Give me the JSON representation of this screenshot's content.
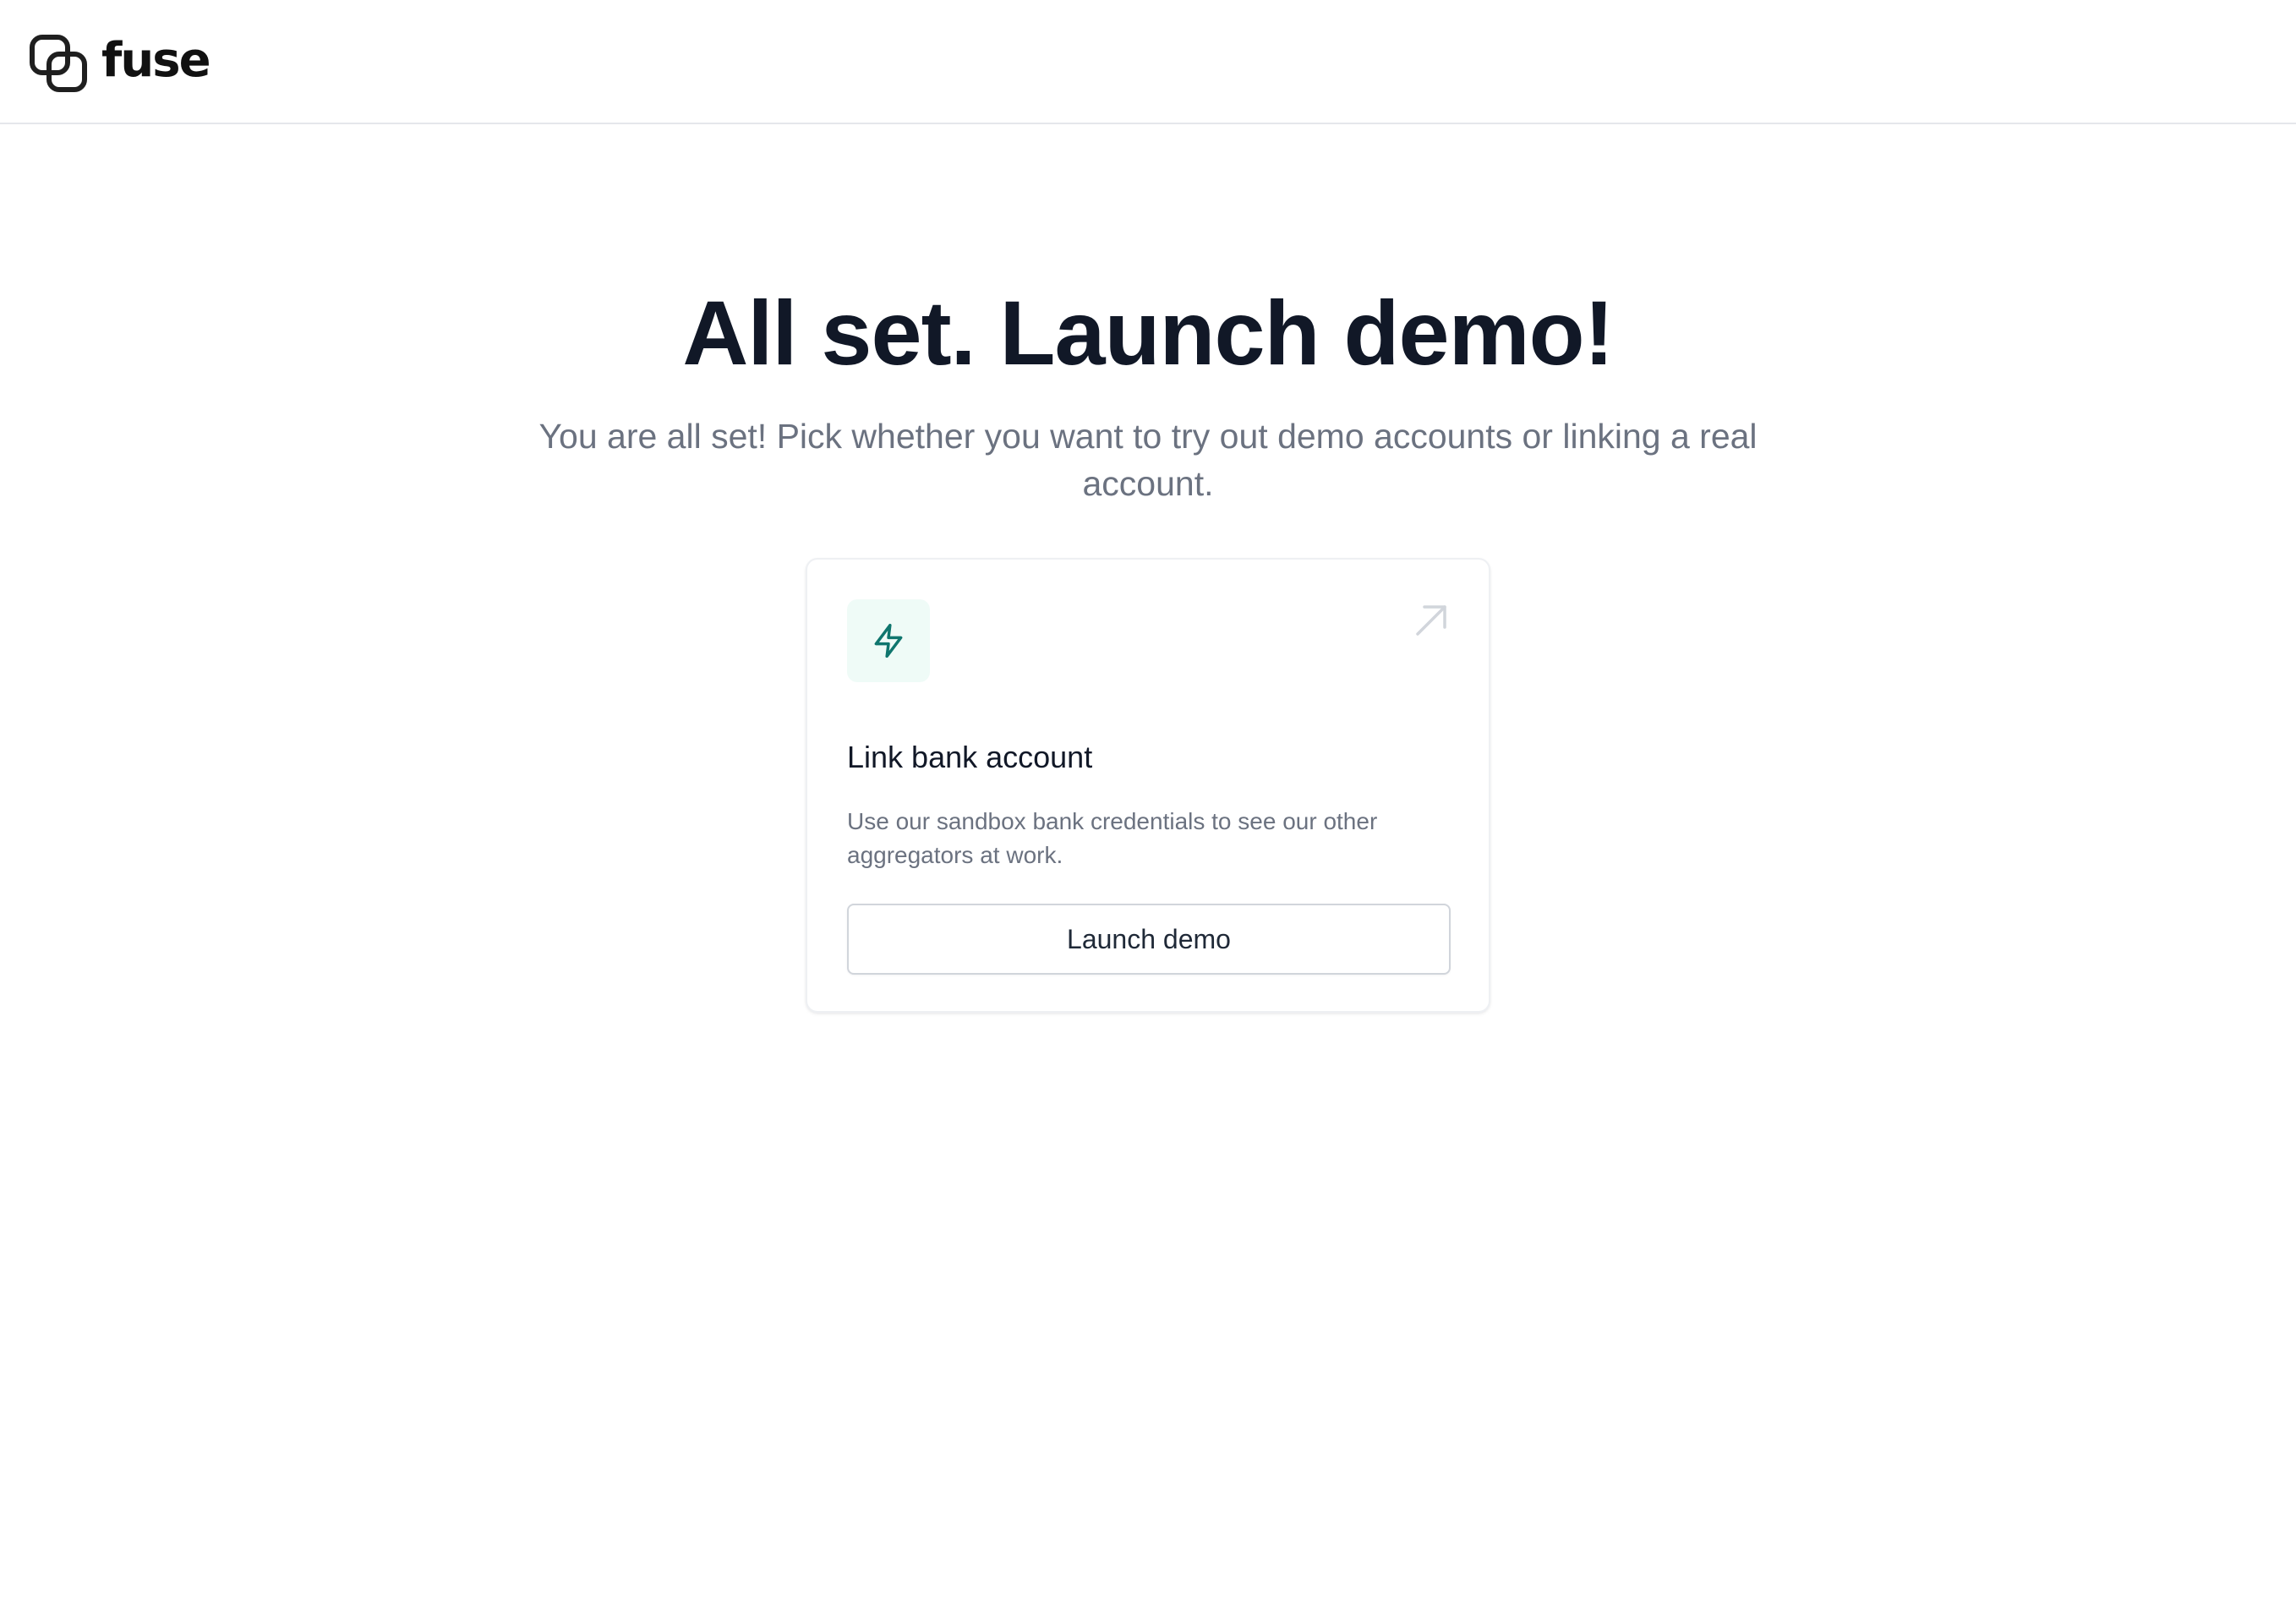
{
  "header": {
    "brand_name": "fuse",
    "logo_icon": "fuse-logo-icon"
  },
  "hero": {
    "title": "All set. Launch demo!",
    "subtitle": "You are all set! Pick whether you want to try out demo accounts or linking a real account."
  },
  "card": {
    "icon": "lightning-bolt-icon",
    "corner_icon": "arrow-up-right-icon",
    "title": "Link bank account",
    "description": "Use our sandbox bank credentials to see our other aggregators at work.",
    "button_label": "Launch demo"
  },
  "colors": {
    "accent": "#0f766e",
    "icon_background": "#effbf7",
    "heading": "#111827",
    "muted_text": "#6b7280",
    "border": "#e5e7eb"
  }
}
